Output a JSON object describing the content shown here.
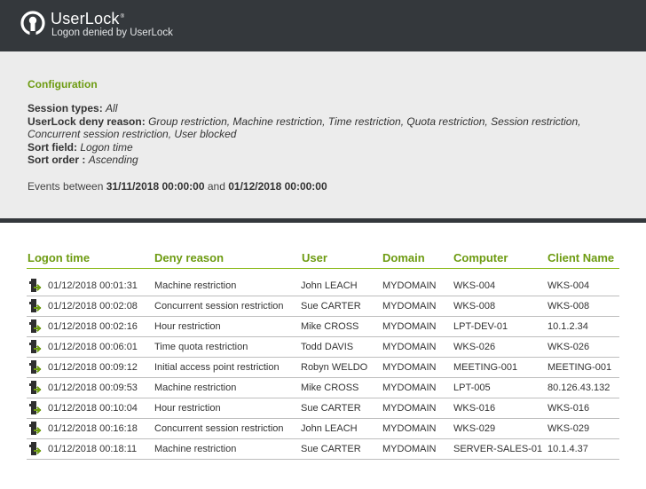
{
  "header": {
    "brand": "UserLock",
    "trademark": "®",
    "subtitle": "Logon denied by UserLock",
    "bg_color": "#34383c"
  },
  "config": {
    "title": "Configuration",
    "session_types_label": "Session types:",
    "session_types_value": "All",
    "deny_reason_label": "UserLock deny reason:",
    "deny_reason_value": "Group restriction, Machine restriction, Time restriction, Quota restriction, Session restriction, Concurrent session restriction, User blocked",
    "sort_field_label": "Sort field:",
    "sort_field_value": "Logon time",
    "sort_order_label": "Sort order :",
    "sort_order_value": "Ascending",
    "events_prefix": "Events between",
    "events_start": "31/11/2018 00:00:00",
    "events_and": "and",
    "events_end": "01/12/2018 00:00:00",
    "accent_color": "#6d9b11"
  },
  "table": {
    "columns": [
      "Logon time",
      "Deny reason",
      "User",
      "Domain",
      "Computer",
      "Client Name"
    ],
    "row_icon": "logon-denied-icon",
    "rows": [
      [
        "01/12/2018 00:01:31",
        "Machine restriction",
        "John LEACH",
        "MYDOMAIN",
        "WKS-004",
        "WKS-004"
      ],
      [
        "01/12/2018 00:02:08",
        "Concurrent session restriction",
        "Sue CARTER",
        "MYDOMAIN",
        "WKS-008",
        "WKS-008"
      ],
      [
        "01/12/2018 00:02:16",
        "Hour restriction",
        "Mike CROSS",
        "MYDOMAIN",
        "LPT-DEV-01",
        "10.1.2.34"
      ],
      [
        "01/12/2018 00:06:01",
        "Time quota restriction",
        "Todd DAVIS",
        "MYDOMAIN",
        "WKS-026",
        "WKS-026"
      ],
      [
        "01/12/2018 00:09:12",
        "Initial access point restriction",
        "Robyn WELDO",
        "MYDOMAIN",
        "MEETING-001",
        "MEETING-001"
      ],
      [
        "01/12/2018 00:09:53",
        "Machine restriction",
        "Mike CROSS",
        "MYDOMAIN",
        "LPT-005",
        "80.126.43.132"
      ],
      [
        "01/12/2018 00:10:04",
        "Hour restriction",
        "Sue CARTER",
        "MYDOMAIN",
        "WKS-016",
        "WKS-016"
      ],
      [
        "01/12/2018 00:16:18",
        "Concurrent session restriction",
        "John LEACH",
        "MYDOMAIN",
        "WKS-029",
        "WKS-029"
      ],
      [
        "01/12/2018 00:18:11",
        "Machine restriction",
        "Sue CARTER",
        "MYDOMAIN",
        "SERVER-SALES-01",
        "10.1.4.37"
      ]
    ]
  }
}
